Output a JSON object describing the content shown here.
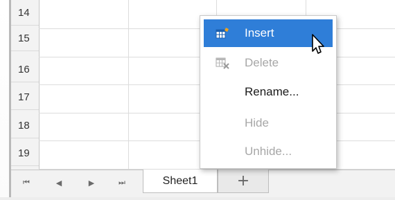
{
  "rows": [
    "14",
    "15",
    "16",
    "17",
    "18",
    "19"
  ],
  "tabs": {
    "nav": {
      "first": "⏮",
      "prev": "◀",
      "next": "▶",
      "last": "⏭"
    },
    "sheet": "Sheet1",
    "add": "+"
  },
  "context_menu": {
    "insert": {
      "label": "Insert",
      "icon": "insert-sheet-icon",
      "state": "highlighted"
    },
    "delete": {
      "label": "Delete",
      "icon": "delete-sheet-icon",
      "state": "disabled"
    },
    "rename": {
      "label": "Rename...",
      "state": "enabled"
    },
    "hide": {
      "label": "Hide",
      "state": "disabled"
    },
    "unhide": {
      "label": "Unhide...",
      "state": "disabled"
    }
  },
  "colors": {
    "highlight": "#2f7ed8",
    "disabled_text": "#a7a7a7",
    "grid_line": "#dcdcdc"
  }
}
